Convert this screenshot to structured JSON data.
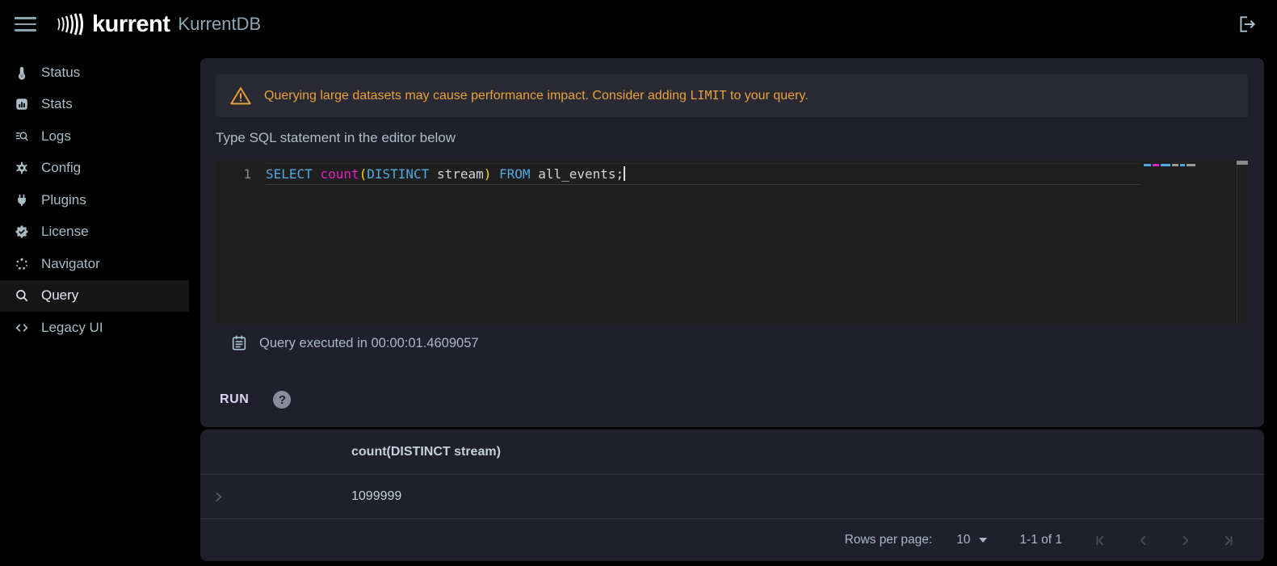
{
  "colors": {
    "warning": "#e9a13b",
    "brand-title": "#8ea7b5",
    "syntax-keyword": "#4fa9e0",
    "syntax-function": "#e320c6",
    "syntax-paren": "#ffd700",
    "syntax-identifier": "#d4d4d4",
    "run-accent": "#d9d4ef"
  },
  "topbar": {
    "brand": "kurrent",
    "product": "KurrentDB"
  },
  "sidebar": {
    "items": [
      {
        "label": "Status"
      },
      {
        "label": "Stats"
      },
      {
        "label": "Logs"
      },
      {
        "label": "Config"
      },
      {
        "label": "Plugins"
      },
      {
        "label": "License"
      },
      {
        "label": "Navigator"
      },
      {
        "label": "Query",
        "active": true
      },
      {
        "label": "Legacy UI"
      }
    ]
  },
  "query_panel": {
    "warning_text_before": "Querying large datasets may cause performance impact. Consider adding ",
    "warning_code": "LIMIT",
    "warning_text_after": " to your query.",
    "editor_label": "Type SQL statement in the editor below",
    "editor": {
      "line_number": "1",
      "tokens": [
        {
          "text": "SELECT ",
          "type": "keyword"
        },
        {
          "text": "count",
          "type": "function"
        },
        {
          "text": "(",
          "type": "paren"
        },
        {
          "text": "DISTINCT",
          "type": "keyword"
        },
        {
          "text": " stream",
          "type": "identifier"
        },
        {
          "text": ")",
          "type": "paren"
        },
        {
          "text": " ",
          "type": "plain"
        },
        {
          "text": "FROM",
          "type": "keyword"
        },
        {
          "text": " all_events;",
          "type": "identifier"
        }
      ]
    },
    "executed_text": "Query executed in 00:00:01.4609057",
    "run_label": "RUN",
    "help_label": "?"
  },
  "results": {
    "column_header": "count(DISTINCT stream)",
    "rows": [
      {
        "value": "1099999"
      }
    ],
    "pagination": {
      "rows_per_page_label": "Rows per page:",
      "rows_per_page_value": "10",
      "range_label": "1-1 of 1"
    }
  }
}
